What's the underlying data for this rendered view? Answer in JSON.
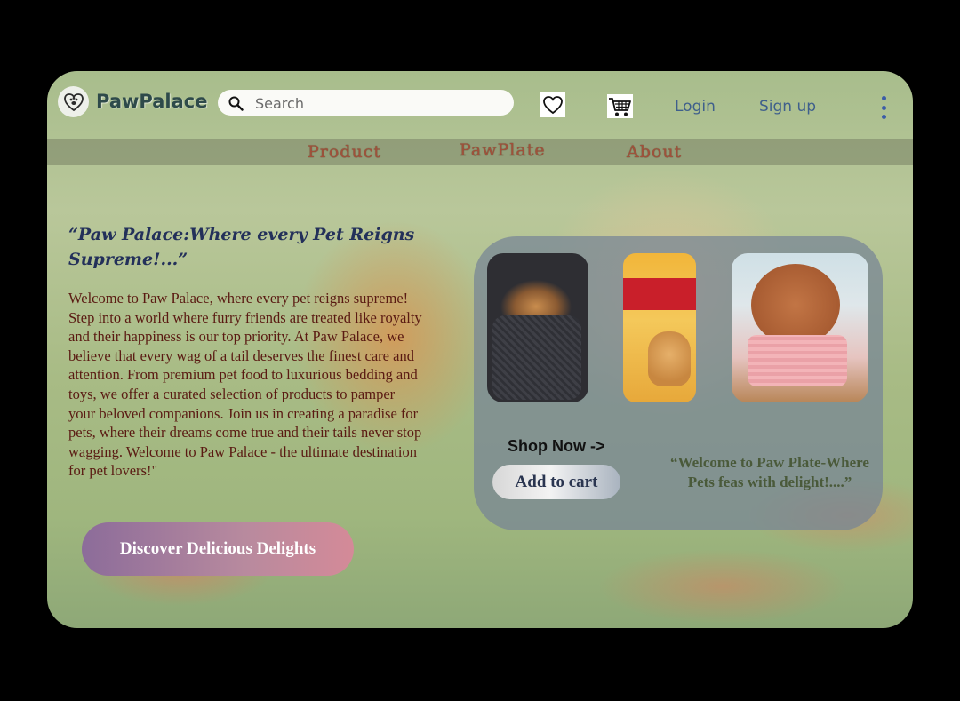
{
  "brand": {
    "name": "PawPalace",
    "logo_icon": "paw-heart-icon"
  },
  "search": {
    "placeholder": "Search",
    "icon": "search-icon"
  },
  "header": {
    "wishlist_icon": "heart-icon",
    "cart_icon": "cart-icon",
    "login_label": "Login",
    "signup_label": "Sign up",
    "menu_icon": "kebab-menu-icon"
  },
  "subnav": {
    "tabs": [
      "Product",
      "PawPlate",
      "About"
    ]
  },
  "hero": {
    "title": "“Paw Palace:Where every Pet Reigns Supreme!...”",
    "body": "Welcome to Paw Palace, where every pet reigns supreme! Step into a world where furry friends are treated like royalty and their happiness is our top priority. At Paw Palace, we believe that every wag of a tail deserves the finest care and attention. From premium pet food to luxurious bedding and toys, we offer a curated selection of products to pamper your beloved companions. Join us in creating a paradise for pets, where their dreams come true and their tails never stop wagging. Welcome to Paw Palace - the ultimate destination for pet lovers!\"",
    "cta_label": "Discover Delicious Delights"
  },
  "shop": {
    "images": [
      "dog-bed-image",
      "pedigree-dog-food-image",
      "dog-grooming-image"
    ],
    "shop_now_label": "Shop Now ->",
    "add_to_cart_label": "Add to cart",
    "quote": "“Welcome to Paw Plate-Where Pets feas with delight!....”"
  },
  "colors": {
    "brand_text": "#2e4a4a",
    "link": "#3f5f8c",
    "subnav_text": "#a0513a",
    "hero_title": "#23305a",
    "hero_body": "#5a1a12",
    "panel": "#76849a"
  }
}
